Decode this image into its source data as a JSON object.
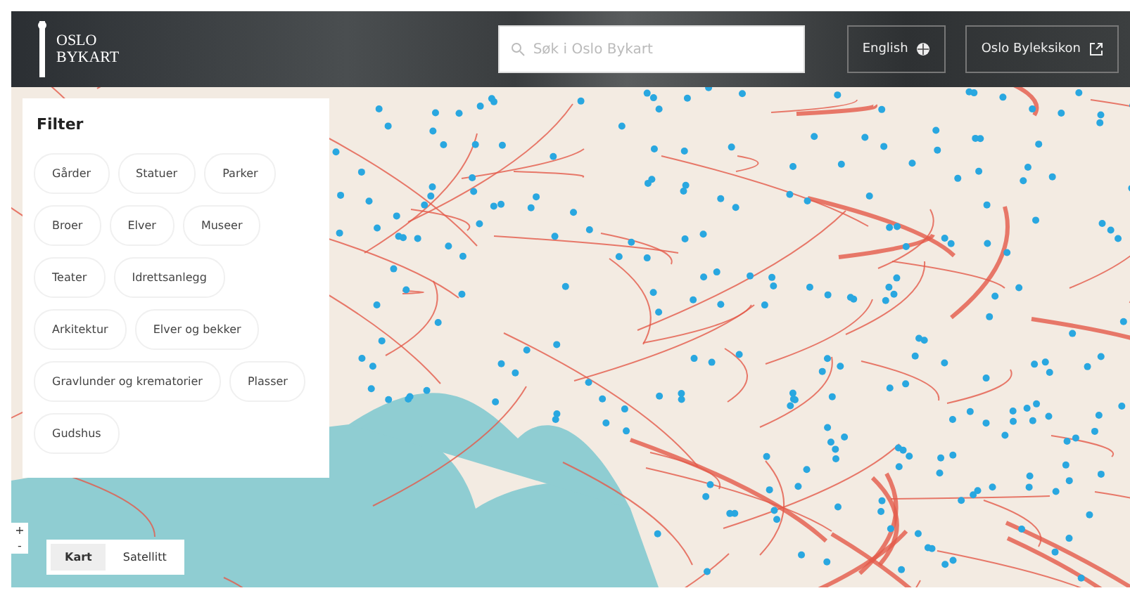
{
  "header": {
    "logo": [
      "OSLO",
      "BYKART"
    ],
    "search": {
      "placeholder": "Søk i Oslo Bykart"
    },
    "language_button": "English",
    "link_button": "Oslo Byleksikon"
  },
  "filter": {
    "title": "Filter",
    "chips": [
      {
        "label": "Gårder",
        "selected": false
      },
      {
        "label": "Statuer",
        "selected": false
      },
      {
        "label": "Parker",
        "selected": false
      },
      {
        "label": "Broer",
        "selected": false
      },
      {
        "label": "Elver",
        "selected": false
      },
      {
        "label": "Museer",
        "selected": false
      },
      {
        "label": "Teater",
        "selected": false
      },
      {
        "label": "Idrettsanlegg",
        "selected": false
      },
      {
        "label": "Arkitektur",
        "selected": false
      },
      {
        "label": "Elver og bekker",
        "selected": false
      },
      {
        "label": "Gravlunder og krematorier",
        "selected": false
      },
      {
        "label": "Plasser",
        "selected": false
      },
      {
        "label": "Gudshus",
        "selected": false
      }
    ]
  },
  "zoom": {
    "in": "+",
    "out": "-"
  },
  "map_types": [
    {
      "label": "Kart",
      "selected": true
    },
    {
      "label": "Satellitt",
      "selected": false
    }
  ]
}
